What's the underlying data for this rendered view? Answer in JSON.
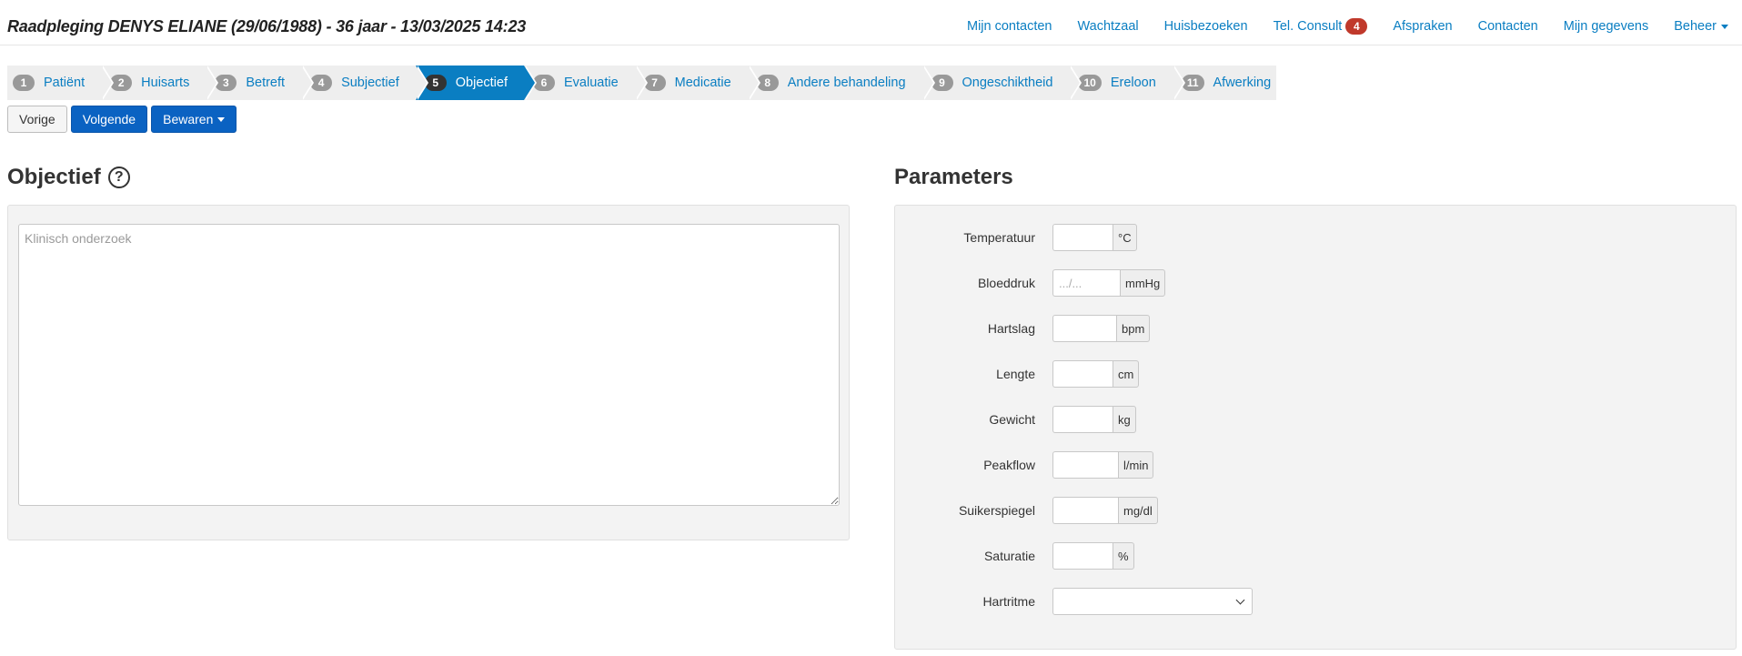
{
  "header": {
    "title": "Raadpleging DENYS ELIANE (29/06/1988) - 36 jaar - 13/03/2025 14:23",
    "nav": [
      {
        "id": "mijn-contacten",
        "label": "Mijn contacten"
      },
      {
        "id": "wachtzaal",
        "label": "Wachtzaal"
      },
      {
        "id": "huisbezoeken",
        "label": "Huisbezoeken"
      },
      {
        "id": "tel-consult",
        "label": "Tel. Consult",
        "badge": "4"
      },
      {
        "id": "afspraken",
        "label": "Afspraken"
      },
      {
        "id": "contacten",
        "label": "Contacten"
      },
      {
        "id": "mijn-gegevens",
        "label": "Mijn gegevens"
      },
      {
        "id": "beheer",
        "label": "Beheer"
      }
    ]
  },
  "steps": [
    {
      "num": "1",
      "label": "Patiënt"
    },
    {
      "num": "2",
      "label": "Huisarts"
    },
    {
      "num": "3",
      "label": "Betreft"
    },
    {
      "num": "4",
      "label": "Subjectief"
    },
    {
      "num": "5",
      "label": "Objectief",
      "active": true
    },
    {
      "num": "6",
      "label": "Evaluatie"
    },
    {
      "num": "7",
      "label": "Medicatie"
    },
    {
      "num": "8",
      "label": "Andere behandeling"
    },
    {
      "num": "9",
      "label": "Ongeschiktheid"
    },
    {
      "num": "10",
      "label": "Ereloon"
    },
    {
      "num": "11",
      "label": "Afwerking"
    }
  ],
  "actions": {
    "prev_label": "Vorige",
    "next_label": "Volgende",
    "save_label": "Bewaren"
  },
  "objectief": {
    "heading": "Objectief",
    "help_glyph": "?",
    "exam_placeholder": "Klinisch onderzoek",
    "exam_value": ""
  },
  "parameters": {
    "heading": "Parameters",
    "fields": [
      {
        "id": "temperatuur",
        "label": "Temperatuur",
        "unit": "°C",
        "value": "",
        "placeholder": ""
      },
      {
        "id": "bloeddruk",
        "label": "Bloeddruk",
        "unit": "mmHg",
        "value": "",
        "placeholder": ".../..."
      },
      {
        "id": "hartslag",
        "label": "Hartslag",
        "unit": "bpm",
        "value": "",
        "placeholder": ""
      },
      {
        "id": "lengte",
        "label": "Lengte",
        "unit": "cm",
        "value": "",
        "placeholder": ""
      },
      {
        "id": "gewicht",
        "label": "Gewicht",
        "unit": "kg",
        "value": "",
        "placeholder": ""
      },
      {
        "id": "peakflow",
        "label": "Peakflow",
        "unit": "l/min",
        "value": "",
        "placeholder": ""
      },
      {
        "id": "suikerspiegel",
        "label": "Suikerspiegel",
        "unit": "mg/dl",
        "value": "",
        "placeholder": ""
      },
      {
        "id": "saturatie",
        "label": "Saturatie",
        "unit": "%",
        "value": "",
        "placeholder": ""
      }
    ],
    "hartritme": {
      "label": "Hartritme",
      "selected": ""
    }
  },
  "colors": {
    "link": "#0a7ec2",
    "active_step": "#0a7ec2",
    "primary_button": "#0a62c2",
    "badge": "#c0392b"
  }
}
